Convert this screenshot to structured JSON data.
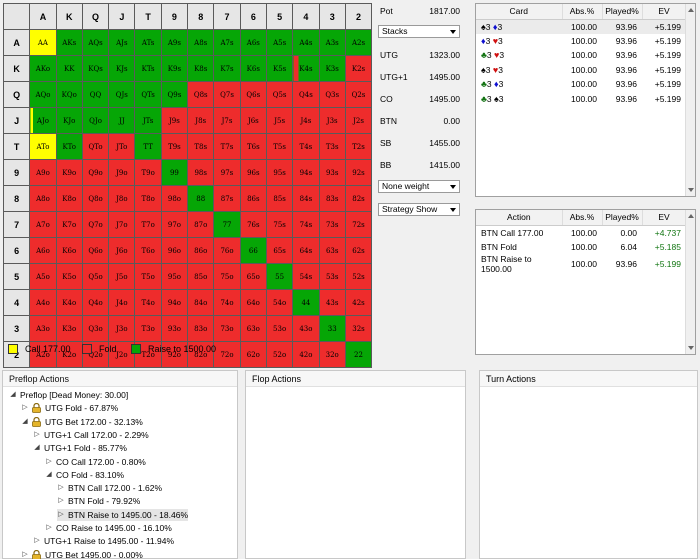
{
  "grid": {
    "header": [
      "",
      "A",
      "K",
      "Q",
      "J",
      "T",
      "9",
      "8",
      "7",
      "6",
      "5",
      "4",
      "3",
      "2"
    ],
    "rows": [
      {
        "rank": "A",
        "cells": [
          "AA",
          "AKs",
          "AQs",
          "AJs",
          "ATs",
          "A9s",
          "A8s",
          "A7s",
          "A6s",
          "A5s",
          "A4s",
          "A3s",
          "A2s"
        ]
      },
      {
        "rank": "K",
        "cells": [
          "AKo",
          "KK",
          "KQs",
          "KJs",
          "KTs",
          "K9s",
          "K8s",
          "K7s",
          "K6s",
          "K5s",
          "K4s",
          "K3s",
          "K2s"
        ]
      },
      {
        "rank": "Q",
        "cells": [
          "AQo",
          "KQo",
          "QQ",
          "QJs",
          "QTs",
          "Q9s",
          "Q8s",
          "Q7s",
          "Q6s",
          "Q5s",
          "Q4s",
          "Q3s",
          "Q2s"
        ]
      },
      {
        "rank": "J",
        "cells": [
          "AJo",
          "KJo",
          "QJo",
          "JJ",
          "JTs",
          "J9s",
          "J8s",
          "J7s",
          "J6s",
          "J5s",
          "J4s",
          "J3s",
          "J2s"
        ]
      },
      {
        "rank": "T",
        "cells": [
          "ATo",
          "KTo",
          "QTo",
          "JTo",
          "TT",
          "T9s",
          "T8s",
          "T7s",
          "T6s",
          "T5s",
          "T4s",
          "T3s",
          "T2s"
        ]
      },
      {
        "rank": "9",
        "cells": [
          "A9o",
          "K9o",
          "Q9o",
          "J9o",
          "T9o",
          "99",
          "98s",
          "97s",
          "96s",
          "95s",
          "94s",
          "93s",
          "92s"
        ]
      },
      {
        "rank": "8",
        "cells": [
          "A8o",
          "K8o",
          "Q8o",
          "J8o",
          "T8o",
          "98o",
          "88",
          "87s",
          "86s",
          "85s",
          "84s",
          "83s",
          "82s"
        ]
      },
      {
        "rank": "7",
        "cells": [
          "A7o",
          "K7o",
          "Q7o",
          "J7o",
          "T7o",
          "97o",
          "87o",
          "77",
          "76s",
          "75s",
          "74s",
          "73s",
          "72s"
        ]
      },
      {
        "rank": "6",
        "cells": [
          "A6o",
          "K6o",
          "Q6o",
          "J6o",
          "T6o",
          "96o",
          "86o",
          "76o",
          "66",
          "65s",
          "64s",
          "63s",
          "62s"
        ]
      },
      {
        "rank": "5",
        "cells": [
          "A5o",
          "K5o",
          "Q5o",
          "J5o",
          "T5o",
          "95o",
          "85o",
          "75o",
          "65o",
          "55",
          "54s",
          "53s",
          "52s"
        ]
      },
      {
        "rank": "4",
        "cells": [
          "A4o",
          "K4o",
          "Q4o",
          "J4o",
          "T4o",
          "94o",
          "84o",
          "74o",
          "64o",
          "54o",
          "44",
          "43s",
          "42s"
        ]
      },
      {
        "rank": "3",
        "cells": [
          "A3o",
          "K3o",
          "Q3o",
          "J3o",
          "T3o",
          "93o",
          "83o",
          "73o",
          "63o",
          "53o",
          "43o",
          "33",
          "32s"
        ]
      },
      {
        "rank": "2",
        "cells": [
          "A2o",
          "K2o",
          "Q2o",
          "J2o",
          "T2o",
          "92o",
          "82o",
          "72o",
          "62o",
          "52o",
          "42o",
          "32o",
          "22"
        ]
      }
    ],
    "colors": [
      [
        "y",
        "g",
        "g",
        "g",
        "g",
        "g",
        "g",
        "g",
        "g",
        "g",
        "g",
        "g",
        "g"
      ],
      [
        "g",
        "g",
        "g",
        "g",
        "g",
        "g",
        "g",
        "g",
        "g",
        "g",
        "s",
        "g",
        "r"
      ],
      [
        "g",
        "g",
        "g",
        "g",
        "g",
        "g",
        "r",
        "r",
        "r",
        "r",
        "r",
        "r",
        "r"
      ],
      [
        "sy",
        "g",
        "g",
        "g",
        "g",
        "r",
        "r",
        "r",
        "r",
        "r",
        "r",
        "r",
        "r"
      ],
      [
        "y",
        "g",
        "r",
        "r",
        "g",
        "r",
        "r",
        "r",
        "r",
        "r",
        "r",
        "r",
        "r"
      ],
      [
        "r",
        "r",
        "r",
        "r",
        "r",
        "g",
        "r",
        "r",
        "r",
        "r",
        "r",
        "r",
        "r"
      ],
      [
        "r",
        "r",
        "r",
        "r",
        "r",
        "r",
        "g",
        "r",
        "r",
        "r",
        "r",
        "r",
        "r"
      ],
      [
        "r",
        "r",
        "r",
        "r",
        "r",
        "r",
        "r",
        "g",
        "r",
        "r",
        "r",
        "r",
        "r"
      ],
      [
        "r",
        "r",
        "r",
        "r",
        "r",
        "r",
        "r",
        "r",
        "g",
        "r",
        "r",
        "r",
        "r"
      ],
      [
        "r",
        "r",
        "r",
        "r",
        "r",
        "r",
        "r",
        "r",
        "r",
        "g",
        "r",
        "r",
        "r"
      ],
      [
        "r",
        "r",
        "r",
        "r",
        "r",
        "r",
        "r",
        "r",
        "r",
        "r",
        "g",
        "r",
        "r"
      ],
      [
        "r",
        "r",
        "r",
        "r",
        "r",
        "r",
        "r",
        "r",
        "r",
        "r",
        "r",
        "g",
        "r"
      ],
      [
        "r",
        "r",
        "r",
        "r",
        "r",
        "r",
        "r",
        "r",
        "r",
        "r",
        "r",
        "r",
        "g"
      ]
    ],
    "palette": {
      "r": "#ee2c2c",
      "g": "#06a606",
      "y": "#ffff00"
    }
  },
  "legend": [
    {
      "label": "Call 177.00",
      "color": "#ffff00"
    },
    {
      "label": "Fold",
      "color": "#ee2c2c"
    },
    {
      "label": "Raise to 1500.00",
      "color": "#06a606"
    }
  ],
  "info": {
    "pot_label": "Pot",
    "pot_value": "1817.00",
    "stacks_select": "Stacks",
    "players": [
      {
        "label": "UTG",
        "value": "1323.00"
      },
      {
        "label": "UTG+1",
        "value": "1495.00"
      },
      {
        "label": "CO",
        "value": "1495.00"
      },
      {
        "label": "BTN",
        "value": "0.00"
      },
      {
        "label": "SB",
        "value": "1455.00"
      },
      {
        "label": "BB",
        "value": "1415.00"
      }
    ],
    "weight_select": "None weight",
    "strategy_select": "Strategy Show"
  },
  "cards_table": {
    "headers": [
      "Card",
      "Abs.%",
      "Played%",
      "EV"
    ],
    "rows": [
      {
        "c1": {
          "r": "3",
          "s": "♠",
          "cls": "s-s"
        },
        "c2": {
          "r": "3",
          "s": "♦",
          "cls": "s-d"
        },
        "abs": "100.00",
        "played": "93.96",
        "ev": "+5.199"
      },
      {
        "c1": {
          "r": "3",
          "s": "♦",
          "cls": "s-d"
        },
        "c2": {
          "r": "3",
          "s": "♥",
          "cls": "s-h"
        },
        "abs": "100.00",
        "played": "93.96",
        "ev": "+5.199"
      },
      {
        "c1": {
          "r": "3",
          "s": "♣",
          "cls": "s-c2"
        },
        "c2": {
          "r": "3",
          "s": "♥",
          "cls": "s-h"
        },
        "abs": "100.00",
        "played": "93.96",
        "ev": "+5.199"
      },
      {
        "c1": {
          "r": "3",
          "s": "♠",
          "cls": "s-s"
        },
        "c2": {
          "r": "3",
          "s": "♥",
          "cls": "s-h"
        },
        "abs": "100.00",
        "played": "93.96",
        "ev": "+5.199"
      },
      {
        "c1": {
          "r": "3",
          "s": "♣",
          "cls": "s-c2"
        },
        "c2": {
          "r": "3",
          "s": "♦",
          "cls": "s-d"
        },
        "abs": "100.00",
        "played": "93.96",
        "ev": "+5.199"
      },
      {
        "c1": {
          "r": "3",
          "s": "♣",
          "cls": "s-c2"
        },
        "c2": {
          "r": "3",
          "s": "♠",
          "cls": "s-s"
        },
        "abs": "100.00",
        "played": "93.96",
        "ev": "+5.199"
      }
    ]
  },
  "actions_table": {
    "headers": [
      "Action",
      "Abs.%",
      "Played%",
      "EV"
    ],
    "rows": [
      {
        "action": "BTN Call 177.00",
        "abs": "100.00",
        "played": "0.00",
        "ev": "+4.737"
      },
      {
        "action": "BTN Fold",
        "abs": "100.00",
        "played": "6.04",
        "ev": "+5.185"
      },
      {
        "action": "BTN Raise to 1500.00",
        "abs": "100.00",
        "played": "93.96",
        "ev": "+5.199"
      }
    ]
  },
  "panes": {
    "preflop_title": "Preflop Actions",
    "flop_title": "Flop Actions",
    "turn_title": "Turn Actions"
  },
  "tree": [
    {
      "label": "Preflop [Dead Money: 30.00]",
      "level": 0,
      "exp": "◢",
      "lock": false
    },
    {
      "label": "UTG Fold - 67.87%",
      "level": 1,
      "exp": "▷",
      "lock": true
    },
    {
      "label": "UTG Bet 172.00 - 32.13%",
      "level": 1,
      "exp": "◢",
      "lock": true
    },
    {
      "label": "UTG+1 Call 172.00 - 2.29%",
      "level": 2,
      "exp": "▷",
      "lock": false
    },
    {
      "label": "UTG+1 Fold - 85.77%",
      "level": 2,
      "exp": "◢",
      "lock": false
    },
    {
      "label": "CO Call 172.00 - 0.80%",
      "level": 3,
      "exp": "▷",
      "lock": false
    },
    {
      "label": "CO Fold - 83.10%",
      "level": 3,
      "exp": "◢",
      "lock": false
    },
    {
      "label": "BTN Call 172.00 - 1.62%",
      "level": 4,
      "exp": "▷",
      "lock": false
    },
    {
      "label": "BTN Fold - 79.92%",
      "level": 4,
      "exp": "▷",
      "lock": false
    },
    {
      "label": "BTN Raise to 1495.00 - 18.46%",
      "level": 4,
      "exp": "▷",
      "lock": false,
      "selected": true
    },
    {
      "label": "CO Raise to 1495.00 - 16.10%",
      "level": 3,
      "exp": "▷",
      "lock": false
    },
    {
      "label": "UTG+1 Raise to 1495.00 - 11.94%",
      "level": 2,
      "exp": "▷",
      "lock": false
    },
    {
      "label": "UTG Bet 1495.00 - 0.00%",
      "level": 1,
      "exp": "▷",
      "lock": true
    }
  ]
}
